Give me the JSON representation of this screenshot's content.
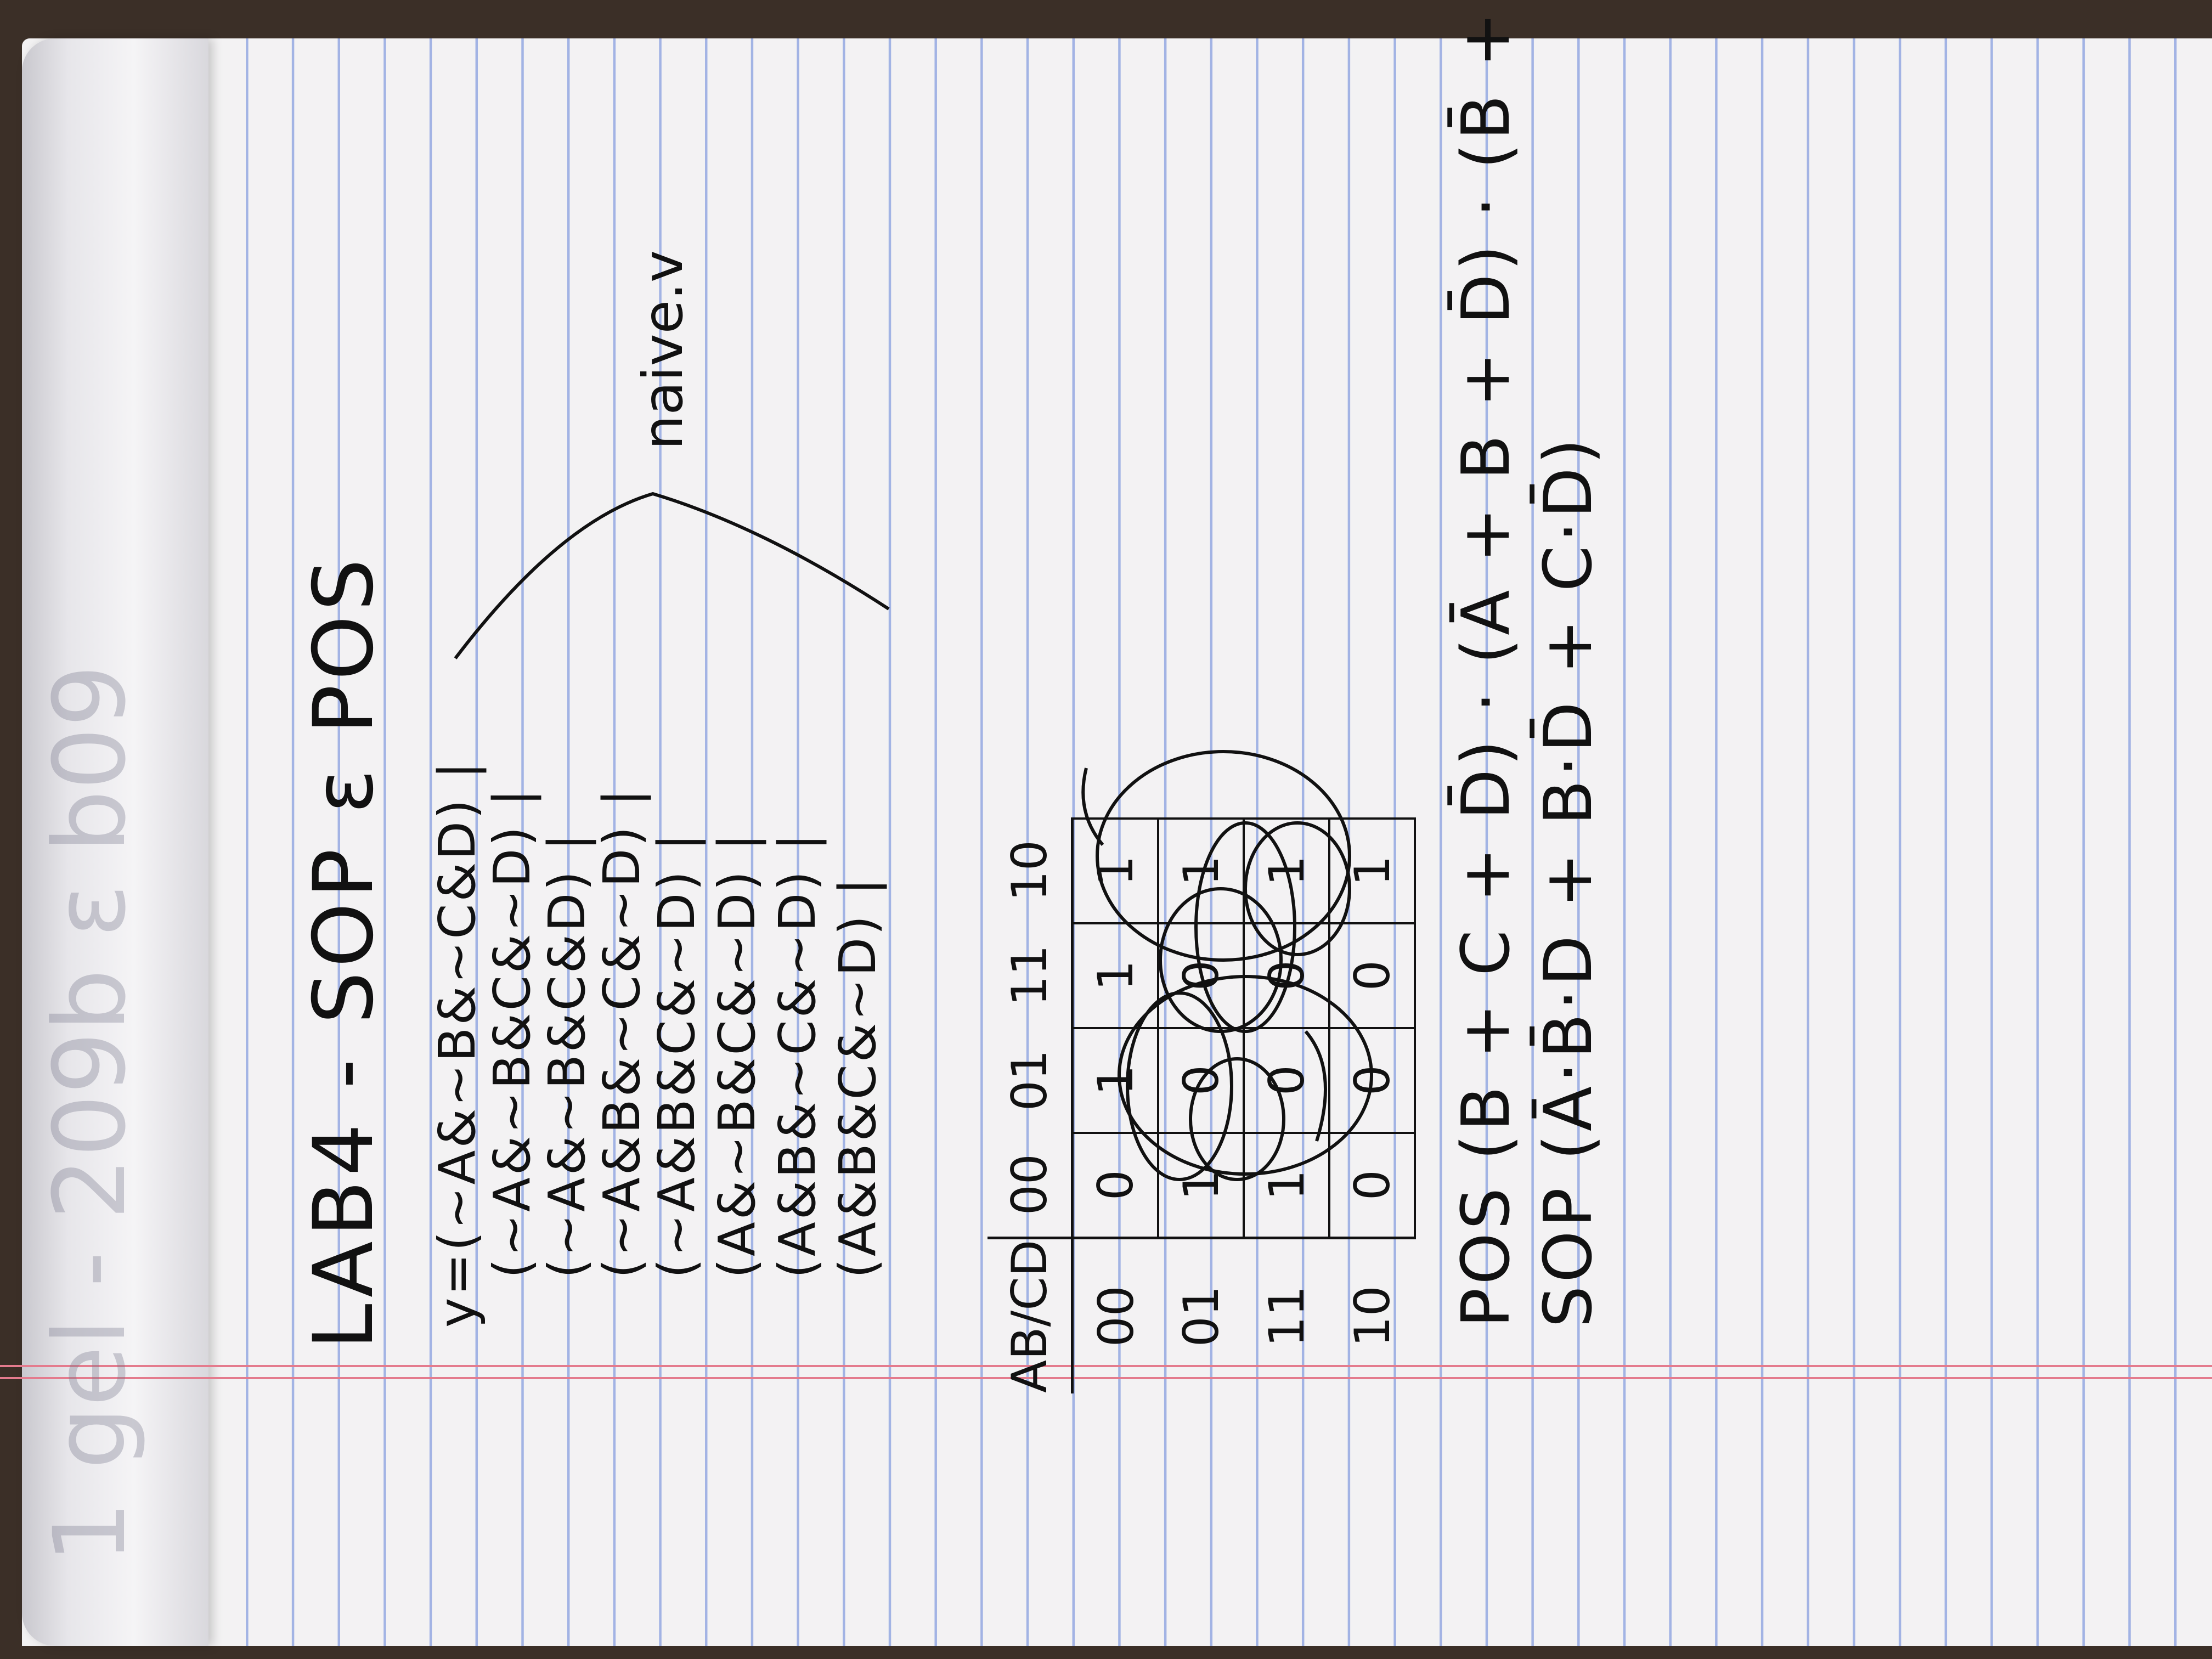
{
  "bleed_through_text": "1 gel - 209b ε b09",
  "title": "LAB4 - SOP ε POS",
  "naive_label": "naive.v",
  "equations": [
    "y=(~A&~B&~C&D) |",
    "(~A&~B&C&~D) |",
    "(~A&~B&C&D) |",
    "(~A&B&~C&~D) |",
    "(~A&B&C&~D) |",
    "(A&~B&C&~D) |",
    "(A&B&~C&~D) |",
    "(A&B&C&~D) |"
  ],
  "kmap": {
    "corner": "AB/CD",
    "col_headers": [
      "00",
      "01",
      "11",
      "10"
    ],
    "rows": [
      {
        "label": "00",
        "cells": [
          "0",
          "1",
          "1",
          "1"
        ]
      },
      {
        "label": "01",
        "cells": [
          "1",
          "0",
          "0",
          "1"
        ]
      },
      {
        "label": "11",
        "cells": [
          "1",
          "0",
          "0",
          "1"
        ]
      },
      {
        "label": "10",
        "cells": [
          "0",
          "0",
          "0",
          "1"
        ]
      }
    ]
  },
  "formulas": {
    "pos": "POS (B + C + D̄) · (Ā + B + D̄) · (B̄ + D)",
    "sop": "SOP (Ā·B̄·D + B·D̄ + C·D̄)"
  }
}
